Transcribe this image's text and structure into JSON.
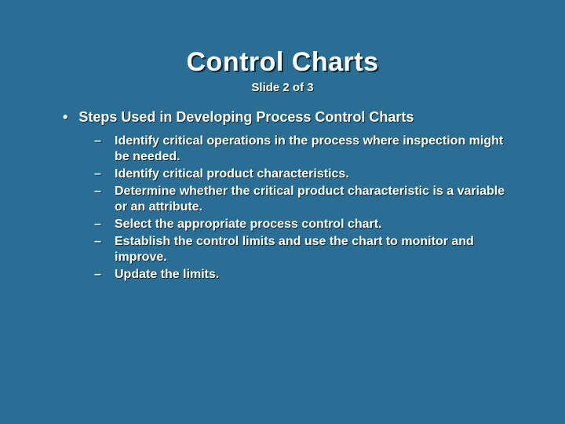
{
  "slide": {
    "title": "Control Charts",
    "subtitle": "Slide 2 of 3",
    "main_bullet": "Steps Used in Developing Process Control Charts",
    "sub_items": [
      "Identify critical operations in the process where inspection might be needed.",
      "Identify critical product characteristics.",
      "Determine whether the critical product characteristic is a variable or an attribute.",
      "Select the appropriate process control chart.",
      "Establish the control limits and use the chart to monitor and improve.",
      "Update the limits."
    ]
  }
}
